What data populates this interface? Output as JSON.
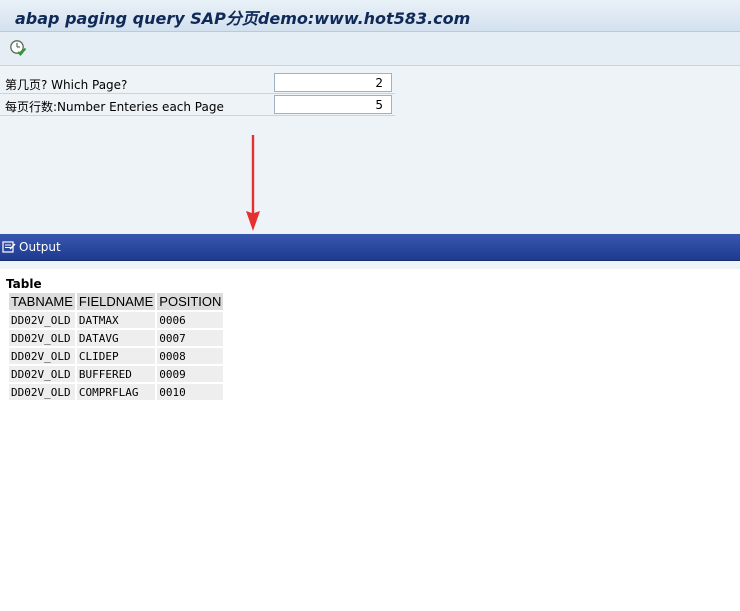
{
  "window": {
    "title": "abap paging query SAP分页demo:www.hot583.com"
  },
  "toolbar": {
    "execute_icon": "execute-clock-icon"
  },
  "selection": {
    "fields": [
      {
        "label": "第几页? Which Page?",
        "value": "2"
      },
      {
        "label": "每页行数:Number Enteries each Page",
        "value": "5"
      }
    ]
  },
  "annotation": {
    "arrow_color": "#e53030"
  },
  "output": {
    "title": "Output",
    "icon": "output-list-icon",
    "caption": "Table",
    "columns": [
      "TABNAME",
      "FIELDNAME",
      "POSITION"
    ],
    "rows": [
      [
        "DD02V_OLD",
        "DATMAX",
        "0006"
      ],
      [
        "DD02V_OLD",
        "DATAVG",
        "0007"
      ],
      [
        "DD02V_OLD",
        "CLIDEP",
        "0008"
      ],
      [
        "DD02V_OLD",
        "BUFFERED",
        "0009"
      ],
      [
        "DD02V_OLD",
        "COMPRFLAG",
        "0010"
      ]
    ]
  },
  "colors": {
    "title_text": "#102a58",
    "output_bar": "#2a47a0"
  }
}
